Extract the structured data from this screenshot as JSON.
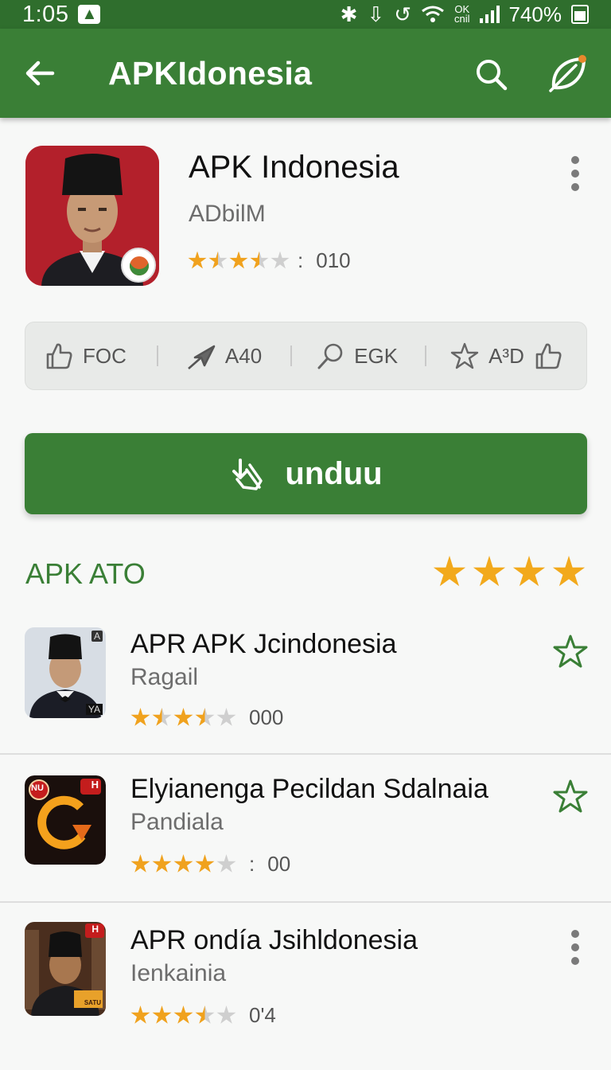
{
  "status_bar": {
    "time": "1:05",
    "network": "OK\ncnil",
    "battery_text": "740%",
    "icons": [
      "notification-icon",
      "bluetooth-icon",
      "download-icon",
      "sync-icon",
      "wifi-icon",
      "signal-icon",
      "battery-icon"
    ]
  },
  "toolbar": {
    "title": "APKIdonesia",
    "back_icon": "arrow-left-icon",
    "search_icon": "search-icon",
    "action_icon": "leaf-icon"
  },
  "app": {
    "name": "APK Indonesia",
    "developer": "ADbilM",
    "rating_stars": 2.5,
    "rating_separator": ":",
    "rating_count": "010"
  },
  "actions": [
    {
      "label": "FOC",
      "icon": "thumbs-up-icon"
    },
    {
      "label": "A40",
      "icon": "plane-icon"
    },
    {
      "label": "EGK",
      "icon": "search-icon"
    },
    {
      "label": "A³D",
      "icon": "star-icon",
      "trailing_icon": "thumbs-up-icon"
    }
  ],
  "download_button": {
    "label": "unduu",
    "icon": "download-tap-icon"
  },
  "section": {
    "title": "APK ATO",
    "stars": 4
  },
  "list": [
    {
      "name": "APR APK Jcindonesia",
      "developer": "Ragail",
      "rating_stars": 2.5,
      "rating_separator": "",
      "count": "000",
      "action": "star-outline-icon",
      "thumb_tag_top": "A",
      "thumb_tag_bottom": "YA"
    },
    {
      "name": "Elyianenga Pecildan Sdalnaia",
      "developer": "Pandiala",
      "rating_stars": 4,
      "rating_separator": ":",
      "count": "00",
      "action": "star-outline-icon",
      "thumb_tag_top": "H",
      "thumb_tag_bottom": "NU"
    },
    {
      "name": "APR ondíа Jsihldonesia",
      "developer": "Ienkainia",
      "rating_stars": 3.5,
      "rating_separator": "",
      "count": "0'4",
      "action": "more-vert-icon",
      "thumb_tag_top": "H",
      "thumb_tag_bottom": "SATU"
    }
  ],
  "colors": {
    "primary": "#3a7f36",
    "status_bar": "#2f6e2d",
    "star": "#f0a21e",
    "background": "#f7f8f7"
  }
}
